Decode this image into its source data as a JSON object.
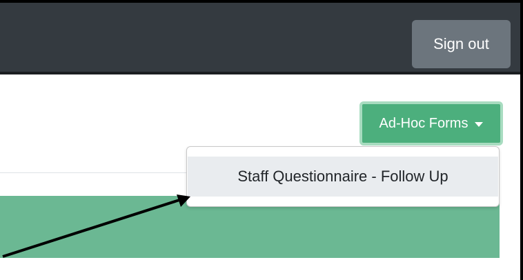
{
  "header": {
    "sign_out_label": "Sign out"
  },
  "toolbar": {
    "adhoc_forms_label": "Ad-Hoc Forms"
  },
  "dropdown": {
    "items": [
      {
        "label": "Staff Questionnaire - Follow Up"
      }
    ]
  },
  "colors": {
    "topbar": "#343a40",
    "sign_out_button": "#6c757d",
    "adhoc_button": "#4caf7d",
    "green_band": "#6bb893",
    "dropdown_item_highlight": "#e9ecef"
  },
  "icons": {
    "dropdown_caret": "caret-down-icon",
    "annotation_arrow": "arrow-annotation"
  }
}
